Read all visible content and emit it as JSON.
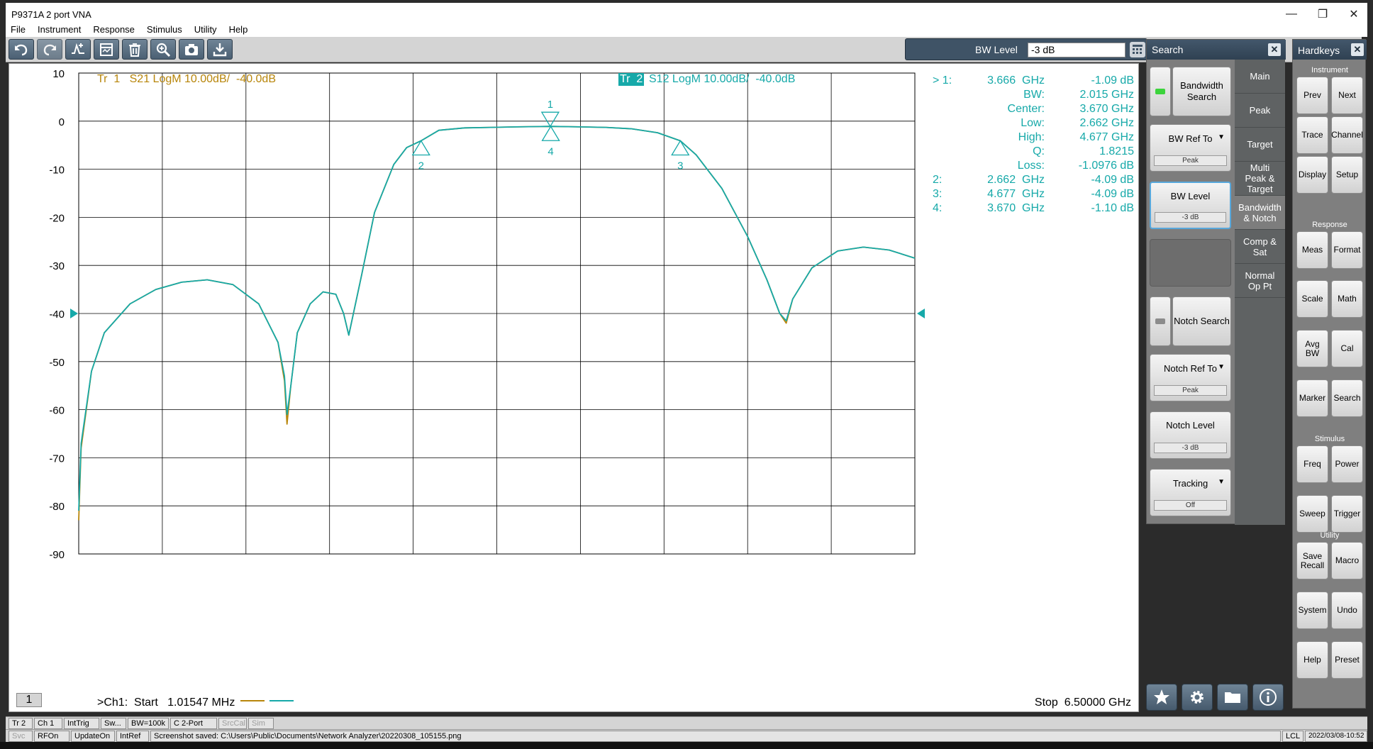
{
  "window": {
    "title": "P9371A 2 port VNA"
  },
  "menu": [
    "File",
    "Instrument",
    "Response",
    "Stimulus",
    "Utility",
    "Help"
  ],
  "toolbar": {
    "icons": [
      "undo-icon",
      "redo-icon",
      "marker-icon",
      "window-icon",
      "delete-icon",
      "zoom-icon",
      "camera-icon",
      "save-icon"
    ],
    "bw_level_label": "BW Level",
    "bw_level_value": "-3 dB"
  },
  "chart": {
    "channel_number": "1",
    "trace1_label": "Tr  1   S21 LogM 10.00dB/  -40.0dB",
    "trace2_tag": "Tr  2",
    "trace2_label": "S12 LogM 10.00dB/  -40.0dB",
    "start_label": ">Ch1:  Start   1.01547 MHz",
    "stop_label": "Stop  6.50000 GHz",
    "marker_readout": [
      {
        "k": "> 1:",
        "mid": "3.666  GHz",
        "val": "-1.09 dB"
      },
      {
        "k": "",
        "mid": "BW:",
        "val": "2.015 GHz"
      },
      {
        "k": "",
        "mid": "Center:",
        "val": "3.670 GHz"
      },
      {
        "k": "",
        "mid": "Low:",
        "val": "2.662 GHz"
      },
      {
        "k": "",
        "mid": "High:",
        "val": "4.677 GHz"
      },
      {
        "k": "",
        "mid": "Q:",
        "val": "1.8215"
      },
      {
        "k": "",
        "mid": "Loss:",
        "val": "-1.0976 dB"
      },
      {
        "k": "2:",
        "mid": "2.662  GHz",
        "val": "-4.09 dB"
      },
      {
        "k": "3:",
        "mid": "4.677  GHz",
        "val": "-4.09 dB"
      },
      {
        "k": "4:",
        "mid": "3.670  GHz",
        "val": "-1.10 dB"
      }
    ]
  },
  "chart_data": {
    "type": "line",
    "xlabel": "",
    "ylabel": "",
    "xlim": [
      0.00101547,
      6.5
    ],
    "ylim": [
      -90,
      10
    ],
    "y_ticks": [
      10,
      0,
      -10,
      -20,
      -30,
      -40,
      -50,
      -60,
      -70,
      -80,
      -90
    ],
    "x_gridlines": 10,
    "reference_level": -40,
    "colors": {
      "trace1": "#b8860b",
      "trace2": "#16a9a9"
    },
    "series": [
      {
        "name": "S21",
        "x": [
          0.001,
          0.02,
          0.1,
          0.2,
          0.4,
          0.6,
          0.8,
          1.0,
          1.2,
          1.4,
          1.55,
          1.6,
          1.62,
          1.65,
          1.7,
          1.8,
          1.9,
          2.0,
          2.06,
          2.1,
          2.2,
          2.3,
          2.45,
          2.55,
          2.662,
          2.8,
          3.0,
          3.2,
          3.4,
          3.666,
          3.9,
          4.1,
          4.3,
          4.5,
          4.677,
          4.8,
          5.0,
          5.2,
          5.35,
          5.45,
          5.5,
          5.55,
          5.7,
          5.9,
          6.1,
          6.3,
          6.5
        ],
        "y": [
          -83,
          -68,
          -52,
          -44,
          -38,
          -35,
          -33.5,
          -33,
          -34,
          -38,
          -46,
          -54,
          -63,
          -55,
          -44,
          -38,
          -35.5,
          -36,
          -40,
          -44.5,
          -32,
          -19,
          -9,
          -5.5,
          -4.09,
          -1.9,
          -1.4,
          -1.3,
          -1.2,
          -1.09,
          -1.2,
          -1.3,
          -1.6,
          -2.4,
          -4.09,
          -7,
          -14,
          -24,
          -33,
          -40,
          -42,
          -37,
          -30.5,
          -27,
          -26.2,
          -26.8,
          -28.5
        ]
      },
      {
        "name": "S12",
        "x": [
          0.001,
          0.02,
          0.1,
          0.2,
          0.4,
          0.6,
          0.8,
          1.0,
          1.2,
          1.4,
          1.55,
          1.6,
          1.62,
          1.65,
          1.7,
          1.8,
          1.9,
          2.0,
          2.06,
          2.1,
          2.2,
          2.3,
          2.45,
          2.55,
          2.662,
          2.8,
          3.0,
          3.2,
          3.4,
          3.666,
          3.9,
          4.1,
          4.3,
          4.5,
          4.677,
          4.8,
          5.0,
          5.2,
          5.35,
          5.45,
          5.5,
          5.55,
          5.7,
          5.9,
          6.1,
          6.3,
          6.5
        ],
        "y": [
          -81,
          -67,
          -52,
          -44,
          -38,
          -35,
          -33.5,
          -33,
          -34,
          -38,
          -46,
          -53,
          -61,
          -55,
          -44,
          -38,
          -35.5,
          -36,
          -40,
          -44.5,
          -32,
          -19,
          -9,
          -5.5,
          -4.09,
          -1.9,
          -1.4,
          -1.3,
          -1.2,
          -1.09,
          -1.2,
          -1.3,
          -1.6,
          -2.4,
          -4.09,
          -7,
          -14,
          -24,
          -33,
          -40,
          -41.5,
          -37,
          -30.5,
          -27,
          -26.2,
          -26.8,
          -28.5
        ]
      }
    ],
    "markers": [
      {
        "label": "1",
        "x": 3.666,
        "y": -1.09,
        "type": "down"
      },
      {
        "label": "4",
        "x": 3.67,
        "y": -1.1,
        "type": "up"
      },
      {
        "label": "2",
        "x": 2.662,
        "y": -4.09,
        "type": "up"
      },
      {
        "label": "3",
        "x": 4.677,
        "y": -4.09,
        "type": "up"
      }
    ]
  },
  "search_panel": {
    "title": "Search",
    "bandwidth_search": "Bandwidth Search",
    "bw_ref_to": "BW Ref To",
    "bw_ref_to_value": "Peak",
    "bw_level": "BW Level",
    "bw_level_value": "-3 dB",
    "notch_search": "Notch Search",
    "notch_ref_to": "Notch Ref To",
    "notch_ref_to_value": "Peak",
    "notch_level": "Notch Level",
    "notch_level_value": "-3 dB",
    "tracking": "Tracking",
    "tracking_value": "Off",
    "tabs": [
      "Main",
      "Peak",
      "Target",
      "Multi Peak & Target",
      "Bandwidth & Notch",
      "Comp & Sat",
      "Normal Op Pt"
    ]
  },
  "hardkeys": {
    "title": "Hardkeys",
    "instrument_label": "Instrument",
    "response_label": "Response",
    "stimulus_label": "Stimulus",
    "utility_label": "Utility",
    "instrument": [
      "Prev",
      "Next",
      "Trace",
      "Channel",
      "Display",
      "Setup"
    ],
    "response": [
      "Meas",
      "Format",
      "Scale",
      "Math",
      "Avg BW",
      "Cal",
      "Marker",
      "Search"
    ],
    "stimulus": [
      "Freq",
      "Power",
      "Sweep",
      "Trigger"
    ],
    "utility": [
      "Save Recall",
      "Macro",
      "System",
      "Undo",
      "Help",
      "Preset"
    ]
  },
  "status": {
    "row1": [
      "Tr 2",
      "Ch 1",
      "IntTrig",
      "Sw...",
      "BW=100k",
      "C  2-Port",
      "SrcCal",
      "Sim"
    ],
    "row2": [
      "Svc",
      "RFOn",
      "UpdateOn",
      "IntRef"
    ],
    "message": "Screenshot saved: C:\\Users\\Public\\Documents\\Network Analyzer\\20220308_105155.png",
    "lcl": "LCL",
    "datetime": "2022/03/08-10:52"
  }
}
